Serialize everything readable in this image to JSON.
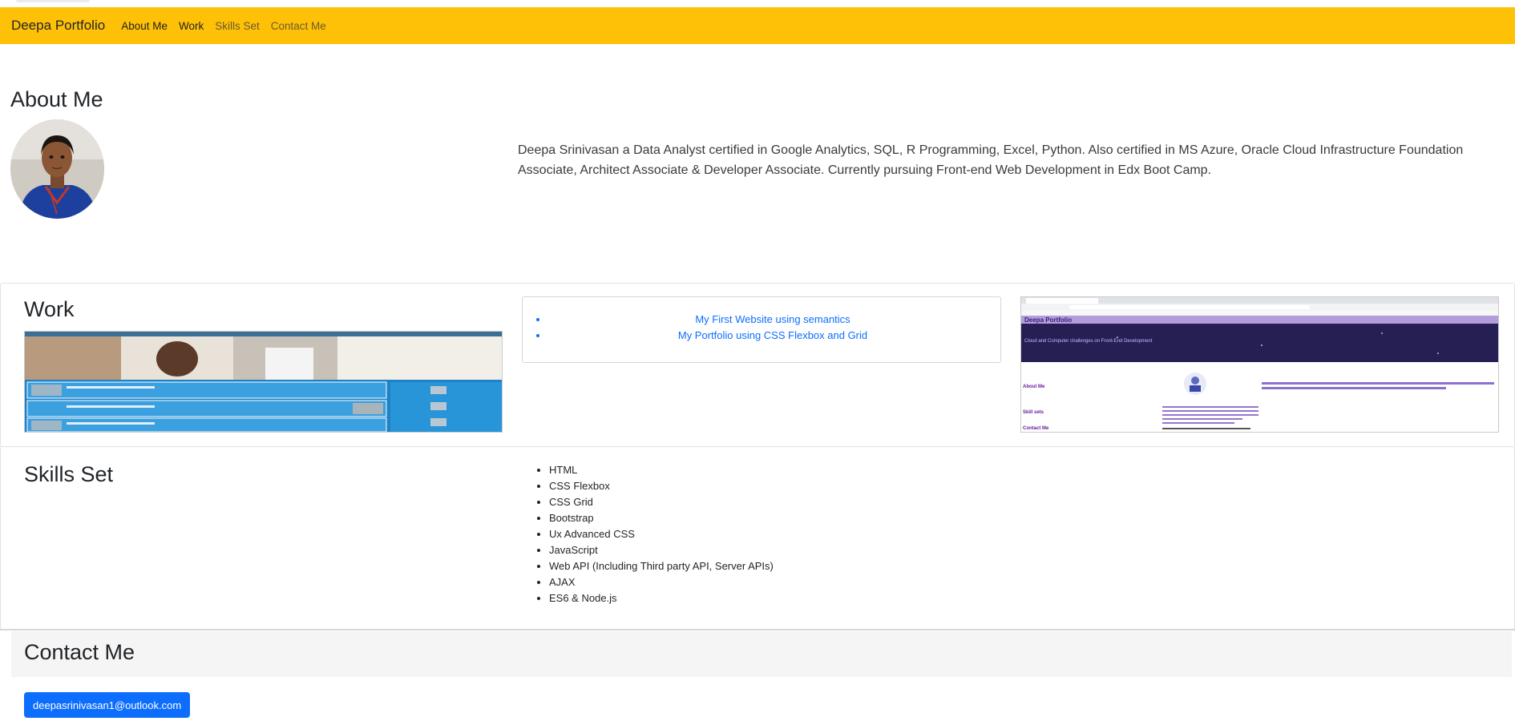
{
  "navbar": {
    "brand": "Deepa Portfolio",
    "links": [
      "About Me",
      "Work",
      "Skills Set",
      "Contact Me"
    ],
    "background": "#ffc107"
  },
  "about": {
    "title": "About Me",
    "text": "Deepa Srinivasan a Data Analyst certified in Google Analytics, SQL, R Programming, Excel, Python. Also certified in MS Azure, Oracle Cloud Infrastructure Foundation Associate, Architect Associate & Developer Associate. Currently pursuing Front-end Web Development in Edx Boot Camp."
  },
  "work": {
    "title": "Work",
    "projects": [
      "My First Website using semantics",
      "My Portfolio using CSS Flexbox and Grid"
    ],
    "thumb2": {
      "brand": "Deepa Portfolio",
      "banner": "Cloud and Computer challenges on Front-End Development",
      "sections": [
        "About Me",
        "Skill sets",
        "Contact Me"
      ]
    }
  },
  "skills": {
    "title": "Skills Set",
    "items": [
      "HTML",
      "CSS Flexbox",
      "CSS Grid",
      "Bootstrap",
      "Ux Advanced CSS",
      "JavaScript",
      "Web API (Including Third party API, Server APIs)",
      "AJAX",
      "ES6 & Node.js"
    ]
  },
  "contact": {
    "title": "Contact Me",
    "email": "deepasrinivasan1@outlook.com"
  },
  "colors": {
    "accent": "#ffc107",
    "link": "#0d6efd",
    "button": "#0d6efd"
  }
}
